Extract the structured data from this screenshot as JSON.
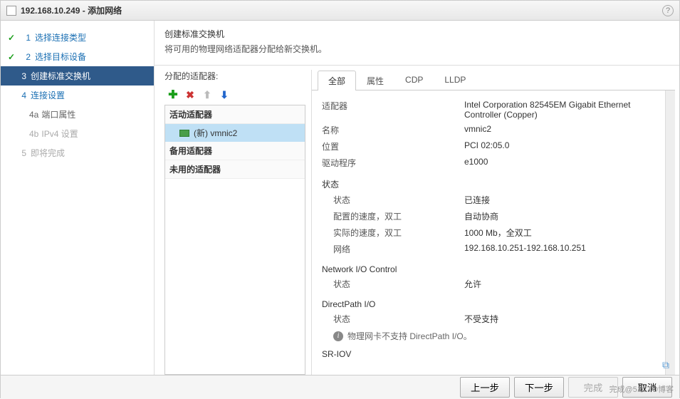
{
  "window": {
    "title": "192.168.10.249 - 添加网络"
  },
  "wizard": {
    "steps": [
      {
        "num": "1",
        "label": "选择连接类型",
        "state": "done"
      },
      {
        "num": "2",
        "label": "选择目标设备",
        "state": "done"
      },
      {
        "num": "3",
        "label": "创建标准交换机",
        "state": "current"
      },
      {
        "num": "4",
        "label": "连接设置",
        "state": "future"
      },
      {
        "num": "4a",
        "label": "端口属性",
        "state": "sub"
      },
      {
        "num": "4b",
        "label": "IPv4 设置",
        "state": "sub-disabled"
      },
      {
        "num": "5",
        "label": "即将完成",
        "state": "future"
      }
    ]
  },
  "header": {
    "title": "创建标准交换机",
    "subtitle": "将可用的物理网络适配器分配给新交换机。"
  },
  "left": {
    "label": "分配的适配器:",
    "groups": {
      "active": "活动适配器",
      "standby": "备用适配器",
      "unused": "未用的适配器"
    },
    "active_item": "(新) vmnic2"
  },
  "tabs": {
    "all": "全部",
    "props": "属性",
    "cdp": "CDP",
    "lldp": "LLDP"
  },
  "details": {
    "adapter_k": "适配器",
    "adapter_v": "Intel Corporation 82545EM Gigabit Ethernet Controller (Copper)",
    "name_k": "名称",
    "name_v": "vmnic2",
    "location_k": "位置",
    "location_v": "PCI 02:05.0",
    "driver_k": "驱动程序",
    "driver_v": "e1000",
    "status_section": "状态",
    "status_k": "状态",
    "status_v": "已连接",
    "cfg_speed_k": "配置的速度，双工",
    "cfg_speed_v": "自动协商",
    "act_speed_k": "实际的速度，双工",
    "act_speed_v": "1000 Mb，全双工",
    "network_k": "网络",
    "network_v": "192.168.10.251-192.168.10.251",
    "nioc_section": "Network I/O Control",
    "nioc_status_k": "状态",
    "nioc_status_v": "允许",
    "dp_section": "DirectPath I/O",
    "dp_status_k": "状态",
    "dp_status_v": "不受支持",
    "dp_note": "物理网卡不支持 DirectPath I/O。",
    "sriov_section": "SR-IOV"
  },
  "buttons": {
    "back": "上一步",
    "next": "下一步",
    "finish": "完成",
    "cancel": "取消"
  },
  "watermark": "完成@51CTO博客"
}
